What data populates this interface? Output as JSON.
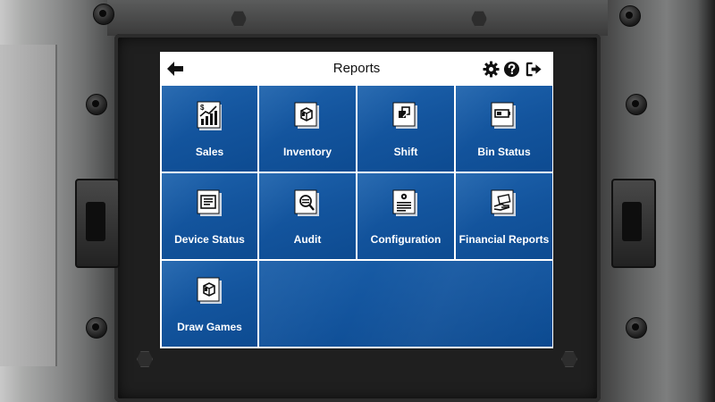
{
  "header": {
    "title": "Reports",
    "icons": [
      "back-arrow-icon",
      "gear-icon",
      "help-icon",
      "logout-icon"
    ]
  },
  "tiles": [
    {
      "label": "Sales",
      "icon": "sales-chart-icon"
    },
    {
      "label": "Inventory",
      "icon": "ticket-pack-icon"
    },
    {
      "label": "Shift",
      "icon": "shift-icon"
    },
    {
      "label": "Bin Status",
      "icon": "battery-icon"
    },
    {
      "label": "Device Status",
      "icon": "device-list-icon"
    },
    {
      "label": "Audit",
      "icon": "magnifier-document-icon"
    },
    {
      "label": "Configuration",
      "icon": "gear-document-icon"
    },
    {
      "label": "Financial Reports",
      "icon": "hand-money-icon"
    },
    {
      "label": "Draw Games",
      "icon": "ticket-pack-icon"
    }
  ],
  "colors": {
    "tile_blue": "#13549d",
    "tile_text": "#ffffff",
    "header_bg": "#ffffff",
    "grid_lines": "#ffffff"
  }
}
